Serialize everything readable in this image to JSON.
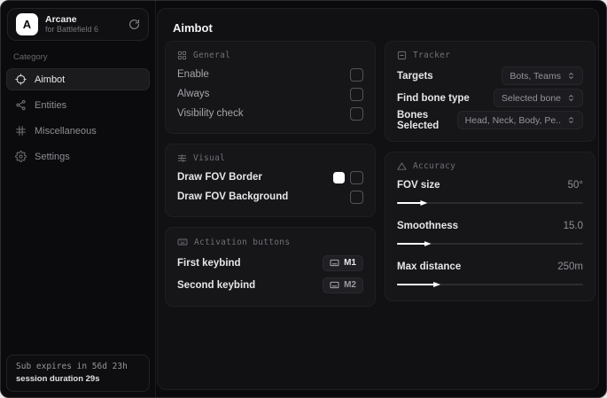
{
  "colors": {
    "accent": "#ffffff",
    "window_bg": "#0a0a0c",
    "panel_bg": "#111114",
    "card_bg": "#161619"
  },
  "sidebar": {
    "brand": {
      "logo_letter": "A",
      "name": "Arcane",
      "subtitle": "for Battlefield 6"
    },
    "category_label": "Category",
    "items": [
      {
        "label": "Aimbot",
        "icon": "crosshair-icon",
        "selected": true
      },
      {
        "label": "Entities",
        "icon": "entities-icon",
        "selected": false
      },
      {
        "label": "Miscellaneous",
        "icon": "miscellaneous-icon",
        "selected": false
      },
      {
        "label": "Settings",
        "icon": "gear-icon",
        "selected": false
      }
    ],
    "footer": {
      "line1": "Sub expires in 56d 23h",
      "line2": "session duration 29s"
    }
  },
  "main": {
    "title": "Aimbot",
    "general": {
      "title": "General",
      "rows": [
        {
          "label": "Enable",
          "checked": false
        },
        {
          "label": "Always",
          "checked": false
        },
        {
          "label": "Visibility check",
          "checked": false
        }
      ]
    },
    "visual": {
      "title": "Visual",
      "rows": [
        {
          "label": "Draw FOV Border",
          "swatch_color": "#ffffff",
          "checked": false
        },
        {
          "label": "Draw FOV Background",
          "checked": false
        }
      ]
    },
    "activation": {
      "title": "Activation buttons",
      "rows": [
        {
          "label": "First keybind",
          "key": "M1"
        },
        {
          "label": "Second keybind",
          "key": "M2"
        }
      ]
    },
    "tracker": {
      "title": "Tracker",
      "rows": [
        {
          "label": "Targets",
          "value": "Bots, Teams"
        },
        {
          "label": "Find bone type",
          "value": "Selected bone"
        },
        {
          "label": "Bones Selected",
          "value": "Head, Neck, Body, Pe.."
        }
      ]
    },
    "accuracy": {
      "title": "Accuracy",
      "sliders": [
        {
          "label": "FOV size",
          "value": "50°",
          "percent": 14
        },
        {
          "label": "Smoothness",
          "value": "15.0",
          "percent": 16
        },
        {
          "label": "Max distance",
          "value": "250m",
          "percent": 21
        }
      ]
    }
  }
}
